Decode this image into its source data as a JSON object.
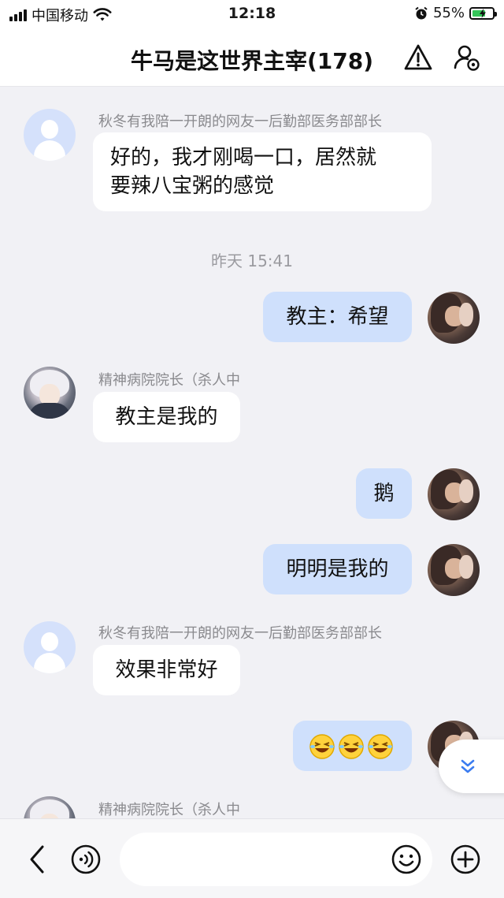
{
  "status_bar": {
    "carrier": "中国移动",
    "time": "12:18",
    "battery_percent": "55%"
  },
  "header": {
    "title": "牛马是这世界主宰(178)",
    "icons": [
      "warning-icon",
      "group-settings-icon"
    ]
  },
  "messages": [
    {
      "type": "incoming",
      "avatar": "default-avatar",
      "sender": "秋冬有我陪一开朗的网友一后勤部医务部部长",
      "text_line1": "好的，我才刚喝一口，居然就",
      "text_line2": "要辣八宝粥的感觉"
    },
    {
      "type": "timestamp",
      "text": "昨天 15:41"
    },
    {
      "type": "outgoing",
      "avatar": "self-avatar",
      "text": "教主：希望"
    },
    {
      "type": "incoming",
      "avatar": "anime-avatar",
      "sender": "精神病院院长（杀人中",
      "text": "教主是我的"
    },
    {
      "type": "outgoing",
      "avatar": "self-avatar",
      "text": "鹅"
    },
    {
      "type": "outgoing",
      "avatar": "self-avatar",
      "text": "明明是我的"
    },
    {
      "type": "incoming",
      "avatar": "default-avatar",
      "sender": "秋冬有我陪一开朗的网友一后勤部医务部部长",
      "text": "效果非常好"
    },
    {
      "type": "outgoing",
      "avatar": "self-avatar",
      "emoji": [
        "laugh-emoji",
        "laugh-emoji",
        "laugh-emoji"
      ]
    },
    {
      "type": "incoming",
      "avatar": "anime-avatar",
      "sender": "精神病院院长（杀人中"
    }
  ],
  "input_bar": {
    "placeholder": "",
    "icons": [
      "back-icon",
      "voice-icon",
      "emoji-icon",
      "plus-icon"
    ]
  },
  "colors": {
    "outgoing_bubble": "#cfe0fc",
    "incoming_bubble": "#ffffff",
    "background": "#f1f1f5",
    "accent": "#3b7cf0"
  }
}
